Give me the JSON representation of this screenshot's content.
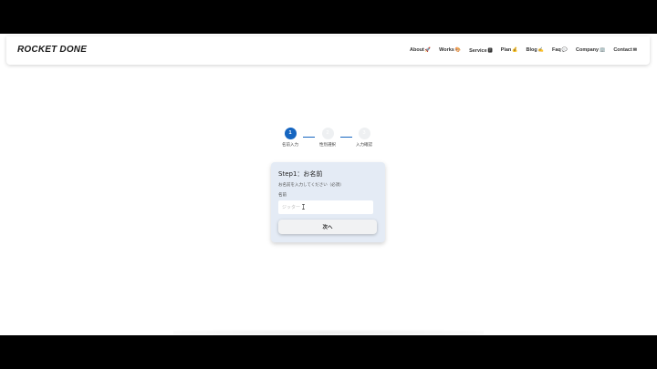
{
  "header": {
    "logo": "ROCKET DONE",
    "nav": [
      {
        "label": "About",
        "emoji": "🚀"
      },
      {
        "label": "Works",
        "emoji": "🎨"
      },
      {
        "label": "Service",
        "emoji": "🅿"
      },
      {
        "label": "Plan",
        "emoji": "💰"
      },
      {
        "label": "Blog",
        "emoji": "✍"
      },
      {
        "label": "Faq",
        "emoji": "💬"
      },
      {
        "label": "Company",
        "emoji": "🏢"
      },
      {
        "label": "Contact",
        "emoji": "✉"
      }
    ]
  },
  "stepper": {
    "steps": [
      {
        "number": "1",
        "label": "名前入力"
      },
      {
        "number": "2",
        "label": "性別選択"
      },
      {
        "number": "3",
        "label": "入力確認"
      }
    ],
    "current": 1,
    "accent": "#1565c0"
  },
  "form": {
    "title": "Step1：お名前",
    "description": "お名前を入力してください（必須）",
    "field_label": "名前",
    "input_placeholder": "ジッター",
    "input_value": "",
    "next_label": "次へ"
  }
}
